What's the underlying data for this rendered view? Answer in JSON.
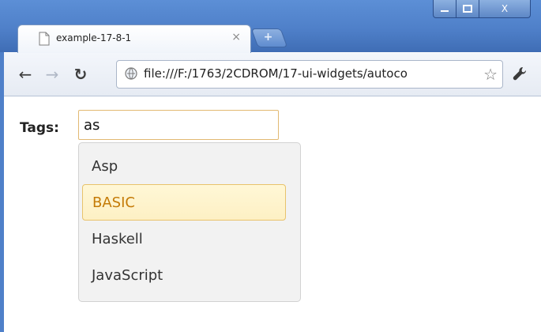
{
  "browser": {
    "tab_title": "example-17-8-1",
    "tab_close": "×",
    "new_tab": "+",
    "url": "file:///F:/1763/2CDROM/17-ui-widgets/autoco",
    "window_controls": {
      "minimize": "",
      "maximize": "",
      "close": "X"
    }
  },
  "page": {
    "label": "Tags:",
    "input_value": "as",
    "suggestions": [
      {
        "text": "Asp",
        "active": false
      },
      {
        "text": "BASIC",
        "active": true
      },
      {
        "text": "Haskell",
        "active": false
      },
      {
        "text": "JavaScript",
        "active": false
      }
    ]
  },
  "colors": {
    "active_item_text": "#c47a06",
    "active_item_border": "#e8c36c",
    "input_border": "#e2b972"
  }
}
